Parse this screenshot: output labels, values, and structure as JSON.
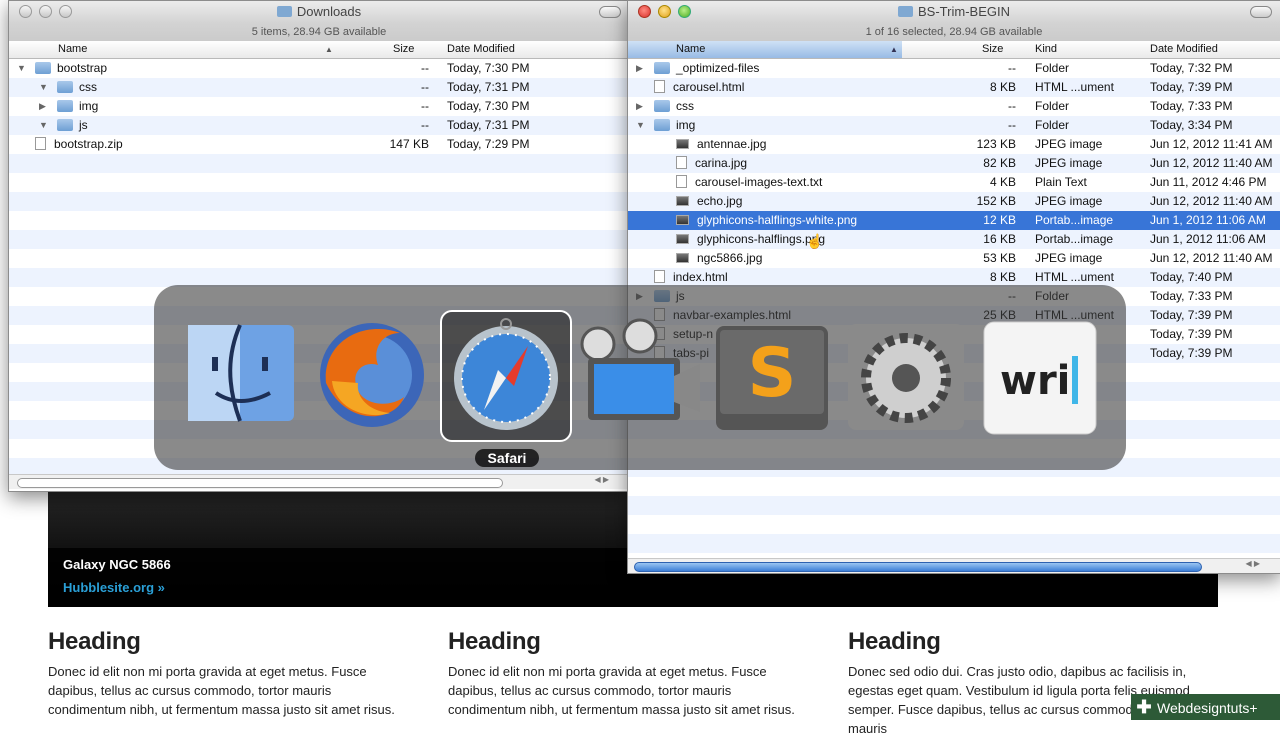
{
  "background_page": {
    "carousel_caption_title": "Galaxy NGC 5866",
    "carousel_caption_link": "Hubblesite.org »",
    "columns": [
      {
        "heading": "Heading",
        "text": "Donec id elit non mi porta gravida at eget metus. Fusce dapibus, tellus ac cursus commodo, tortor mauris condimentum nibh, ut fermentum massa justo sit amet risus."
      },
      {
        "heading": "Heading",
        "text": "Donec id elit non mi porta gravida at eget metus. Fusce dapibus, tellus ac cursus commodo, tortor mauris condimentum nibh, ut fermentum massa justo sit amet risus."
      },
      {
        "heading": "Heading",
        "text": "Donec sed odio dui. Cras justo odio, dapibus ac facilisis in, egestas eget quam. Vestibulum id ligula porta felis euismod semper. Fusce dapibus, tellus ac cursus commodo, tortor mauris"
      }
    ],
    "badge": "Webdesigntuts+"
  },
  "downloads_window": {
    "title": "Downloads",
    "status": "5 items, 28.94 GB available",
    "columns": {
      "name": "Name",
      "size": "Size",
      "date": "Date Modified"
    },
    "rows": [
      {
        "tri": "▼",
        "indent": 0,
        "icon": "folder",
        "name": "bootstrap",
        "size": "--",
        "date": "Today, 7:30 PM"
      },
      {
        "tri": "▼",
        "indent": 1,
        "icon": "folder",
        "name": "css",
        "size": "--",
        "date": "Today, 7:31 PM"
      },
      {
        "tri": "▶",
        "indent": 1,
        "icon": "folder",
        "name": "img",
        "size": "--",
        "date": "Today, 7:30 PM"
      },
      {
        "tri": "▼",
        "indent": 1,
        "icon": "folder",
        "name": "js",
        "size": "--",
        "date": "Today, 7:31 PM"
      },
      {
        "tri": "",
        "indent": 0,
        "icon": "file",
        "name": "bootstrap.zip",
        "size": "147 KB",
        "date": "Today, 7:29 PM"
      }
    ]
  },
  "bs_window": {
    "title": "BS-Trim-BEGIN",
    "status": "1 of 16 selected, 28.94 GB available",
    "columns": {
      "name": "Name",
      "size": "Size",
      "kind": "Kind",
      "date": "Date Modified"
    },
    "rows": [
      {
        "tri": "▶",
        "indent": 0,
        "icon": "folder",
        "name": "_optimized-files",
        "size": "--",
        "kind": "Folder",
        "date": "Today, 7:32 PM",
        "selected": false
      },
      {
        "tri": "",
        "indent": 0,
        "icon": "file",
        "name": "carousel.html",
        "size": "8 KB",
        "kind": "HTML ...ument",
        "date": "Today, 7:39 PM",
        "selected": false
      },
      {
        "tri": "▶",
        "indent": 0,
        "icon": "folder",
        "name": "css",
        "size": "--",
        "kind": "Folder",
        "date": "Today, 7:33 PM",
        "selected": false
      },
      {
        "tri": "▼",
        "indent": 0,
        "icon": "folder",
        "name": "img",
        "size": "--",
        "kind": "Folder",
        "date": "Today, 3:34 PM",
        "selected": false
      },
      {
        "tri": "",
        "indent": 1,
        "icon": "image",
        "name": "antennae.jpg",
        "size": "123 KB",
        "kind": "JPEG image",
        "date": "Jun 12, 2012 11:41 AM",
        "selected": false
      },
      {
        "tri": "",
        "indent": 1,
        "icon": "file",
        "name": "carina.jpg",
        "size": "82 KB",
        "kind": "JPEG image",
        "date": "Jun 12, 2012 11:40 AM",
        "selected": false
      },
      {
        "tri": "",
        "indent": 1,
        "icon": "file",
        "name": "carousel-images-text.txt",
        "size": "4 KB",
        "kind": "Plain Text",
        "date": "Jun 11, 2012 4:46 PM",
        "selected": false
      },
      {
        "tri": "",
        "indent": 1,
        "icon": "image",
        "name": "echo.jpg",
        "size": "152 KB",
        "kind": "JPEG image",
        "date": "Jun 12, 2012 11:40 AM",
        "selected": false
      },
      {
        "tri": "",
        "indent": 1,
        "icon": "image",
        "name": "glyphicons-halflings-white.png",
        "size": "12 KB",
        "kind": "Portab...image",
        "date": "Jun 1, 2012 11:06 AM",
        "selected": true
      },
      {
        "tri": "",
        "indent": 1,
        "icon": "image",
        "name": "glyphicons-halflings.png",
        "size": "16 KB",
        "kind": "Portab...image",
        "date": "Jun 1, 2012 11:06 AM",
        "selected": false
      },
      {
        "tri": "",
        "indent": 1,
        "icon": "image",
        "name": "ngc5866.jpg",
        "size": "53 KB",
        "kind": "JPEG image",
        "date": "Jun 12, 2012 11:40 AM",
        "selected": false
      },
      {
        "tri": "",
        "indent": 0,
        "icon": "file",
        "name": "index.html",
        "size": "8 KB",
        "kind": "HTML ...ument",
        "date": "Today, 7:40 PM",
        "selected": false
      },
      {
        "tri": "▶",
        "indent": 0,
        "icon": "folder",
        "name": "js",
        "size": "--",
        "kind": "Folder",
        "date": "Today, 7:33 PM",
        "selected": false
      },
      {
        "tri": "",
        "indent": 0,
        "icon": "file",
        "name": "navbar-examples.html",
        "size": "25 KB",
        "kind": "HTML ...ument",
        "date": "Today, 7:39 PM",
        "selected": false
      },
      {
        "tri": "",
        "indent": 0,
        "icon": "file",
        "name": "setup-n",
        "size": "",
        "kind": "ument",
        "date": "Today, 7:39 PM",
        "selected": false
      },
      {
        "tri": "",
        "indent": 0,
        "icon": "file",
        "name": "tabs-pi",
        "size": "",
        "kind": "ment",
        "date": "Today, 7:39 PM",
        "selected": false
      }
    ]
  },
  "app_switcher": {
    "apps": [
      {
        "name": "Finder",
        "icon": "finder-icon"
      },
      {
        "name": "Firefox",
        "icon": "firefox-icon"
      },
      {
        "name": "Safari",
        "icon": "safari-icon"
      },
      {
        "name": "Photo Booth / Movie",
        "icon": "movie-icon"
      },
      {
        "name": "Sublime Text",
        "icon": "sublime-icon"
      },
      {
        "name": "System Preferences",
        "icon": "system-preferences-icon"
      },
      {
        "name": "Writer",
        "icon": "writer-icon",
        "text": "wri"
      }
    ],
    "selected_label": "Safari"
  }
}
